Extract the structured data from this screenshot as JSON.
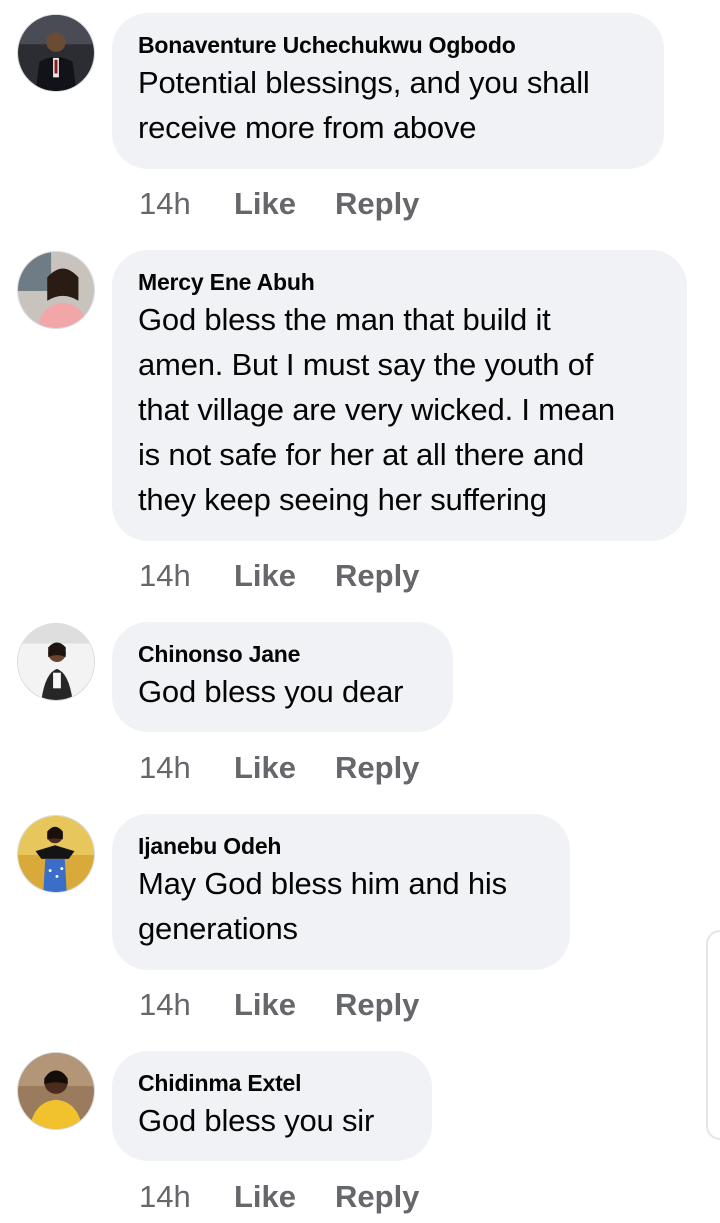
{
  "comments": [
    {
      "author": "Bonaventure Uchechukwu Ogbodo",
      "lines": [
        "Potential blessings, and you shall",
        "receive more from above"
      ],
      "time": "14h",
      "like_label": "Like",
      "reply_label": "Reply"
    },
    {
      "author": "Mercy Ene Abuh",
      "lines": [
        "God bless the man that build it",
        "amen. But I must say the youth of",
        "that village are very wicked. I mean",
        "is not safe for her at all there and",
        "they keep seeing her suffering"
      ],
      "time": "14h",
      "like_label": "Like",
      "reply_label": "Reply"
    },
    {
      "author": "Chinonso Jane",
      "lines": [
        "God bless you dear"
      ],
      "time": "14h",
      "like_label": "Like",
      "reply_label": "Reply"
    },
    {
      "author": "Ijanebu Odeh",
      "lines": [
        "May God bless him and his",
        "generations"
      ],
      "time": "14h",
      "like_label": "Like",
      "reply_label": "Reply"
    },
    {
      "author": "Chidinma Extel",
      "lines": [
        "God bless you sir"
      ],
      "time": "14h",
      "like_label": "Like",
      "reply_label": "Reply"
    }
  ],
  "colors": {
    "bubble": "#f0f2f5",
    "meta_text": "#65676b",
    "primary_text": "#050505"
  }
}
